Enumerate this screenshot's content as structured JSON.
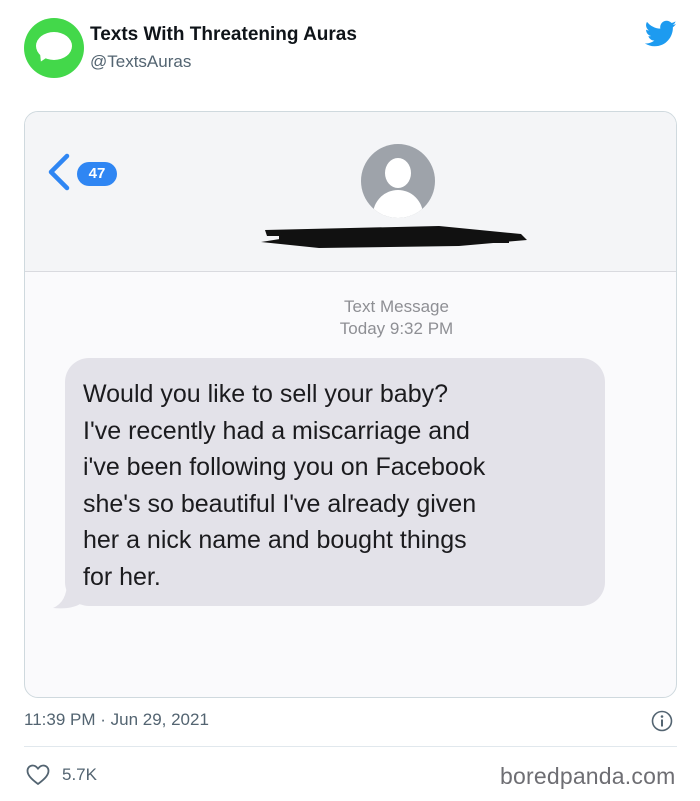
{
  "header": {
    "display_name": "Texts With Threatening Auras",
    "handle": "@TextsAuras"
  },
  "sms": {
    "unread_count": "47",
    "meta_line1": "Text Message",
    "meta_line2": "Today 9:32 PM",
    "message_lines": [
      "Would you like to sell your baby?",
      "I've recently had a miscarriage and",
      "i've been following you on Facebook",
      "she's so beautiful I've already given",
      "her a nick name and bought things",
      "for her."
    ]
  },
  "footer": {
    "timestamp": "11:39 PM · Jun 29, 2021",
    "like_count": "5.7K",
    "watermark": "boredpanda.com"
  },
  "colors": {
    "avatar_green": "#43d84a",
    "twitter_blue": "#1d9bf0",
    "ios_blue": "#2f86f3",
    "bubble_gray": "#e3e2e9"
  },
  "icons": [
    "message-bubble-icon",
    "twitter-bird-icon",
    "back-chevron-icon",
    "contact-silhouette-icon",
    "info-icon",
    "heart-icon"
  ]
}
